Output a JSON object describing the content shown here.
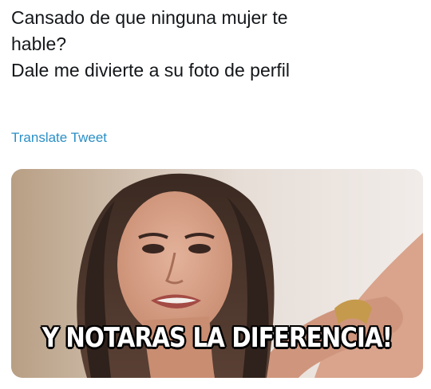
{
  "tweet": {
    "lines": [
      "Cansado de que ninguna mujer te",
      "hable?",
      "Dale me divierte a su foto de perfil"
    ],
    "translate_label": "Translate Tweet"
  },
  "media": {
    "caption": "Y NOTARAS LA DIFERENCIA!",
    "image_alt": "woman-smiling-photo"
  }
}
